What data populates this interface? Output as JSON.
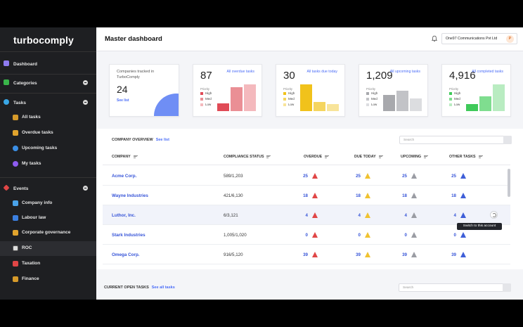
{
  "app": {
    "brand": "turbocomply"
  },
  "sidebar": {
    "dashboard": "Dashboard",
    "categories": "Categories",
    "tasks": "Tasks",
    "task_items": [
      "All tasks",
      "Overdue tasks",
      "Upcoming tasks",
      "My tasks"
    ],
    "events": "Events",
    "event_items": [
      "Company info",
      "Labour law",
      "Corporate governance",
      "ROC",
      "Taxation",
      "Finance"
    ]
  },
  "header": {
    "title": "Master dashboard",
    "company": "One97 Communications Pvt Ltd",
    "avatar": "P"
  },
  "kpis": {
    "tracked": {
      "label": "Companies tracked in TurboComply",
      "value": "24",
      "link": "See list"
    },
    "priority_label": "Priority",
    "legend": [
      "High",
      "Med",
      "Low"
    ],
    "overdue": {
      "value": "87",
      "link": "All overdue tasks",
      "colors": [
        "#e04b57",
        "#ea8f95",
        "#f4b9bd"
      ],
      "levels": [
        0.3,
        0.9,
        1.0
      ]
    },
    "due_today": {
      "value": "30",
      "link": "All tasks due today",
      "colors": [
        "#f1c21b",
        "#f5d55f",
        "#f8e49a"
      ],
      "levels": [
        1.0,
        0.35,
        0.25
      ]
    },
    "upcoming": {
      "value": "1,209",
      "link": "All upcoming tasks",
      "colors": [
        "#a8a9ad",
        "#c2c3c7",
        "#dcdde0"
      ],
      "levels": [
        0.6,
        0.75,
        0.48
      ]
    },
    "completed": {
      "value": "4,916",
      "link": "All completed tasks",
      "colors": [
        "#3fca5a",
        "#7fdd8f",
        "#b9ecc1"
      ],
      "levels": [
        0.25,
        0.55,
        1.0
      ]
    }
  },
  "overview": {
    "title": "COMPANY OVERVIEW",
    "see_list": "See list",
    "search_placeholder": "Search",
    "columns": [
      "COMPANY",
      "COMPLIANCE STATUS",
      "OVERDUE",
      "DUE TODAY",
      "UPCOMING",
      "OTHER TASKS"
    ],
    "rows": [
      {
        "company": "Acme Corp.",
        "status": "589/1,203",
        "overdue": "25",
        "due_today": "25",
        "upcoming": "25",
        "other": "25"
      },
      {
        "company": "Wayne Industries",
        "status": "421/6,130",
        "overdue": "18",
        "due_today": "18",
        "upcoming": "18",
        "other": "18"
      },
      {
        "company": "Luthor, Inc.",
        "status": "6/3,121",
        "overdue": "4",
        "due_today": "4",
        "upcoming": "4",
        "other": "4"
      },
      {
        "company": "Stark Industries",
        "status": "1,005/1,020",
        "overdue": "0",
        "due_today": "0",
        "upcoming": "0",
        "other": "0"
      },
      {
        "company": "Omega Corp.",
        "status": "916/5,120",
        "overdue": "39",
        "due_today": "39",
        "upcoming": "39",
        "other": "39"
      }
    ],
    "tooltip": "Switch to this account"
  },
  "open_tasks": {
    "title": "CURRENT OPEN TASKS",
    "see_all": "See all tasks",
    "search_placeholder": "Search"
  }
}
